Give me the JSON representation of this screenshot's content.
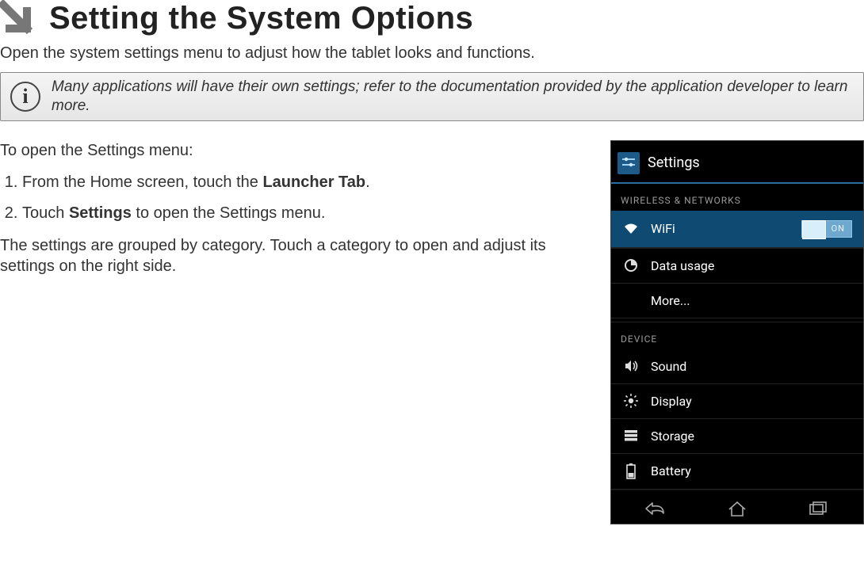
{
  "header": {
    "arrow_icon": "down-right-arrow-icon",
    "title": "Setting the System Options"
  },
  "intro": "Open the system settings menu to adjust how the tablet looks and functions.",
  "info_box": {
    "icon_glyph": "i",
    "text": "Many applications will have their own settings; refer to the documentation provided by the application developer to learn more."
  },
  "body": {
    "lead": "To open the Settings menu:",
    "steps": [
      {
        "pre": "From the Home screen, touch the ",
        "bold": "Launcher Tab",
        "post": "."
      },
      {
        "pre": "Touch ",
        "bold": "Settings",
        "post": " to open the Settings menu."
      }
    ],
    "after": "The settings are grouped by category. Touch a category to open and adjust its settings on the right side."
  },
  "device": {
    "title": "Settings",
    "sections": [
      {
        "header": "WIRELESS & NETWORKS",
        "items": [
          {
            "icon": "wifi-icon",
            "label": "WiFi",
            "selected": true,
            "toggle": "ON"
          },
          {
            "icon": "data-usage-icon",
            "label": "Data usage"
          },
          {
            "icon": null,
            "label": "More..."
          }
        ]
      },
      {
        "header": "DEVICE",
        "items": [
          {
            "icon": "sound-icon",
            "label": "Sound"
          },
          {
            "icon": "display-icon",
            "label": "Display"
          },
          {
            "icon": "storage-icon",
            "label": "Storage"
          },
          {
            "icon": "battery-icon",
            "label": "Battery"
          }
        ]
      }
    ],
    "nav": {
      "back": "back-icon",
      "home": "home-icon",
      "recent": "recent-apps-icon"
    }
  }
}
